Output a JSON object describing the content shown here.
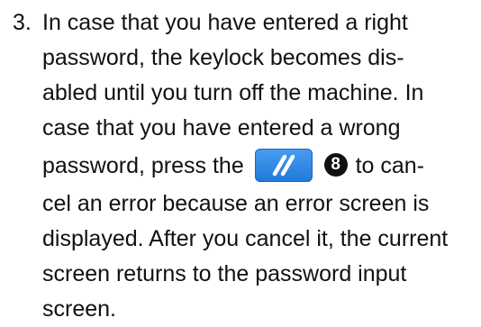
{
  "step": {
    "number": "3.",
    "lines": [
      "In case that you have entered a right",
      "password, the keylock becomes dis-",
      "abled until you turn off the machine. In",
      "case that you have entered a wrong"
    ],
    "icon_line": {
      "before": "password, press the",
      "marker": "8",
      "after": "to can-"
    },
    "lines_after": [
      "cel an error because an error screen is",
      "displayed. After you cancel it, the current",
      "screen returns to the password input",
      "screen."
    ]
  },
  "icons": {
    "cancel_key": "cancel-key-icon",
    "cancel_key_color": "#2f86e4"
  }
}
